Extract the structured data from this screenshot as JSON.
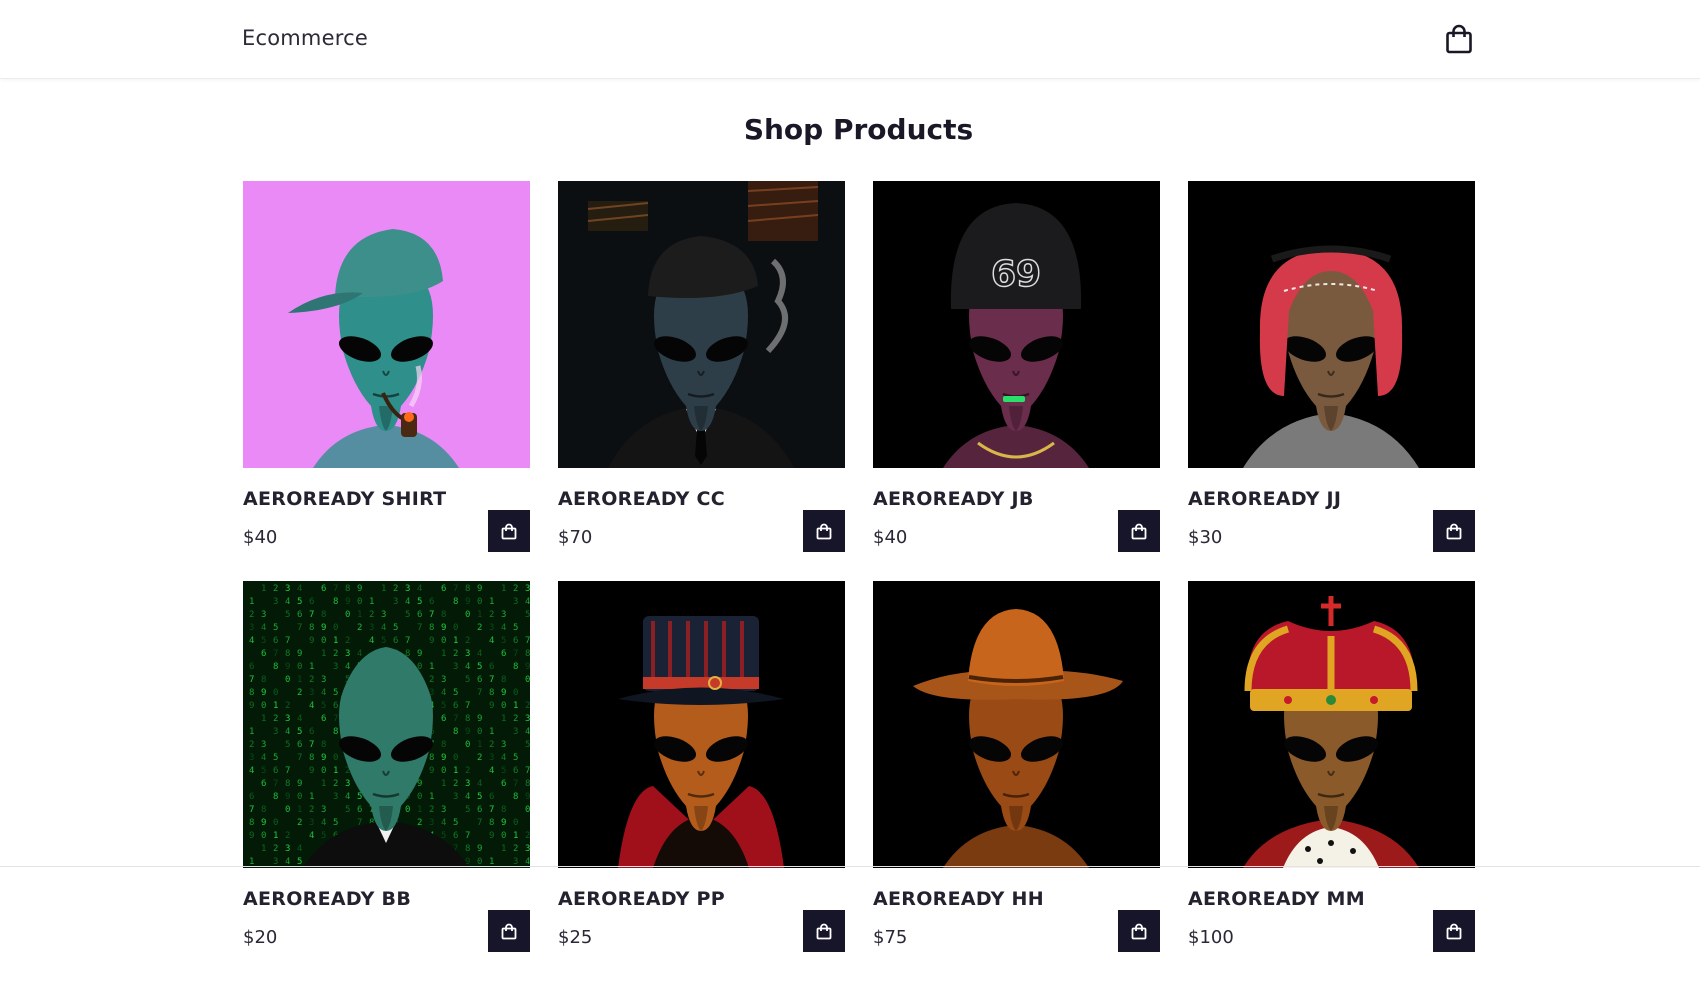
{
  "header": {
    "brand": "Ecommerce",
    "cart_icon": "shopping-bag-icon"
  },
  "page_title": "Shop Products",
  "products": [
    {
      "name": "AEROREADY SHIRT",
      "price": "$40",
      "bg": "#e98af7",
      "skin": "#2f8f8a",
      "hat": "flat-cap",
      "hat_color": "#3d8f8c",
      "extra": "pipe"
    },
    {
      "name": "AEROREADY CC",
      "price": "$70",
      "bg": "#0b0f12",
      "skin": "#2e3e49",
      "hat": "newsboy",
      "hat_color": "#1c1c1c",
      "extra": "suit"
    },
    {
      "name": "AEROREADY JB",
      "price": "$40",
      "bg": "#000000",
      "skin": "#6b2d4c",
      "hat": "beanie",
      "hat_color": "#1b1b1d",
      "extra": "chain"
    },
    {
      "name": "AEROREADY JJ",
      "price": "$30",
      "bg": "#000000",
      "skin": "#7a5a3e",
      "hat": "keffiyeh",
      "hat_color": "#d43a4a",
      "extra": "robe"
    },
    {
      "name": "AEROREADY BB",
      "price": "$20",
      "bg": "#021a06",
      "skin": "#2f7a68",
      "hat": "none",
      "hat_color": "#000000",
      "extra": "matrix"
    },
    {
      "name": "AEROREADY PP",
      "price": "$25",
      "bg": "#000000",
      "skin": "#b45c1c",
      "hat": "top-hat",
      "hat_color": "#1a2236",
      "extra": "cape"
    },
    {
      "name": "AEROREADY HH",
      "price": "$75",
      "bg": "#000000",
      "skin": "#9a4a15",
      "hat": "cowboy",
      "hat_color": "#c8651c",
      "extra": "none"
    },
    {
      "name": "AEROREADY MM",
      "price": "$100",
      "bg": "#000000",
      "skin": "#8a5a2a",
      "hat": "crown",
      "hat_color": "#e0a623",
      "extra": "ermine"
    }
  ],
  "add_button_icon": "shopping-bag-icon",
  "colors": {
    "accent": "#171529",
    "text": "#1f1d2b"
  }
}
